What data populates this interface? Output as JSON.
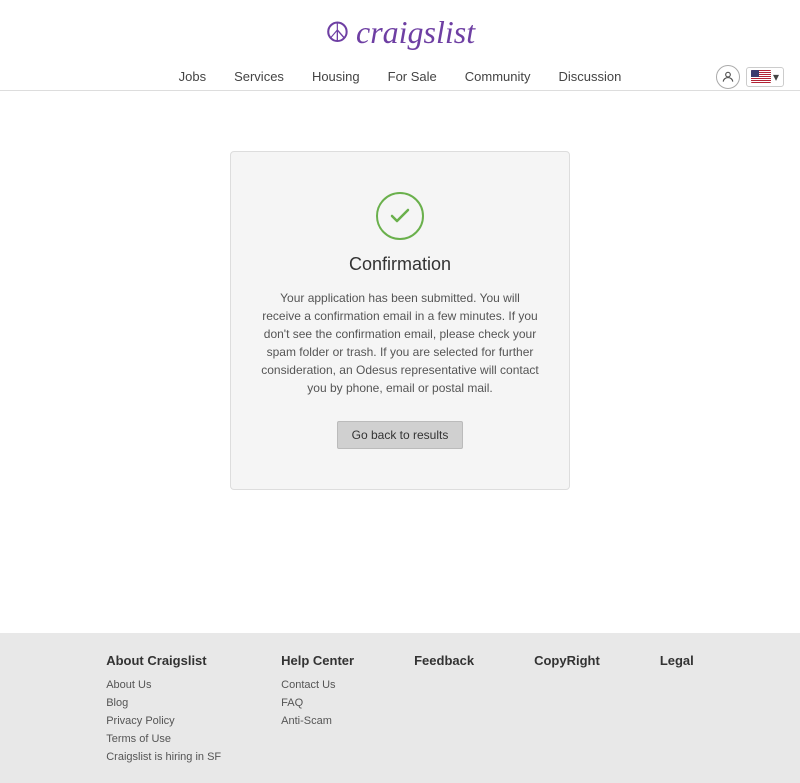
{
  "logo": {
    "peace_symbol": "☮",
    "text": "craigslist"
  },
  "nav": {
    "links": [
      {
        "id": "jobs",
        "label": "Jobs"
      },
      {
        "id": "services",
        "label": "Services"
      },
      {
        "id": "housing",
        "label": "Housing"
      },
      {
        "id": "for-sale",
        "label": "For Sale"
      },
      {
        "id": "community",
        "label": "Community"
      },
      {
        "id": "discussion",
        "label": "Discussion"
      }
    ],
    "chevron": "▾"
  },
  "confirmation": {
    "title": "Confirmation",
    "body": "Your application has been submitted. You will receive a confirmation email in a few minutes. If you don't see the confirmation email, please check your spam folder or trash. If you are selected for further consideration, an Odesus representative will contact you by phone, email or postal mail.",
    "button_label": "Go back to results"
  },
  "footer": {
    "columns": [
      {
        "id": "about",
        "heading": "About Craigslist",
        "links": [
          {
            "label": "About Us"
          },
          {
            "label": "Blog"
          },
          {
            "label": "Privacy Policy"
          },
          {
            "label": "Terms of Use"
          },
          {
            "label": "Craigslist is hiring in SF"
          }
        ]
      },
      {
        "id": "help",
        "heading": "Help Center",
        "links": [
          {
            "label": "Contact Us"
          },
          {
            "label": "FAQ"
          },
          {
            "label": "Anti-Scam"
          }
        ]
      },
      {
        "id": "feedback",
        "heading": "Feedback",
        "links": []
      },
      {
        "id": "copyright",
        "heading": "CopyRight",
        "links": []
      },
      {
        "id": "legal",
        "heading": "Legal",
        "links": []
      }
    ]
  }
}
